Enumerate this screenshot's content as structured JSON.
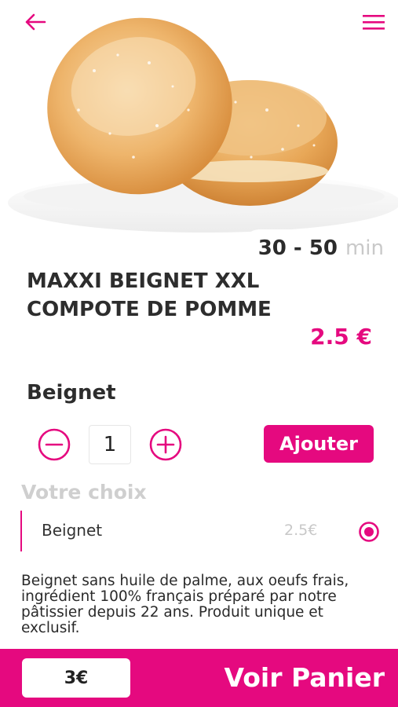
{
  "header": {
    "back_icon": "arrow-left-icon",
    "menu_icon": "hamburger-menu-icon"
  },
  "product": {
    "image": "sugar-donuts-photo",
    "delivery_time": "30 - 50",
    "delivery_unit": "min",
    "title": "MAXXI BEIGNET XXL COMPOTE DE POMME",
    "category": "Beignet",
    "price": "2.5 €",
    "description": "Beignet sans huile de palme, aux oeufs frais, ingrédient 100% français préparé par notre pâtissier depuis 22 ans. Produit unique et exclusif."
  },
  "quantity": {
    "value": "1",
    "minus_icon": "minus-circle-icon",
    "plus_icon": "plus-circle-icon",
    "add_label": "Ajouter"
  },
  "choices": {
    "heading": "Votre choix",
    "options": [
      {
        "label": "Beignet",
        "price": "2.5€",
        "selected": true
      }
    ]
  },
  "footer": {
    "total": "3€",
    "cart_label": "Voir Panier"
  },
  "colors": {
    "accent": "#e5097f",
    "muted_text": "#c8c8c8",
    "primary_text": "#2d2d2d"
  }
}
